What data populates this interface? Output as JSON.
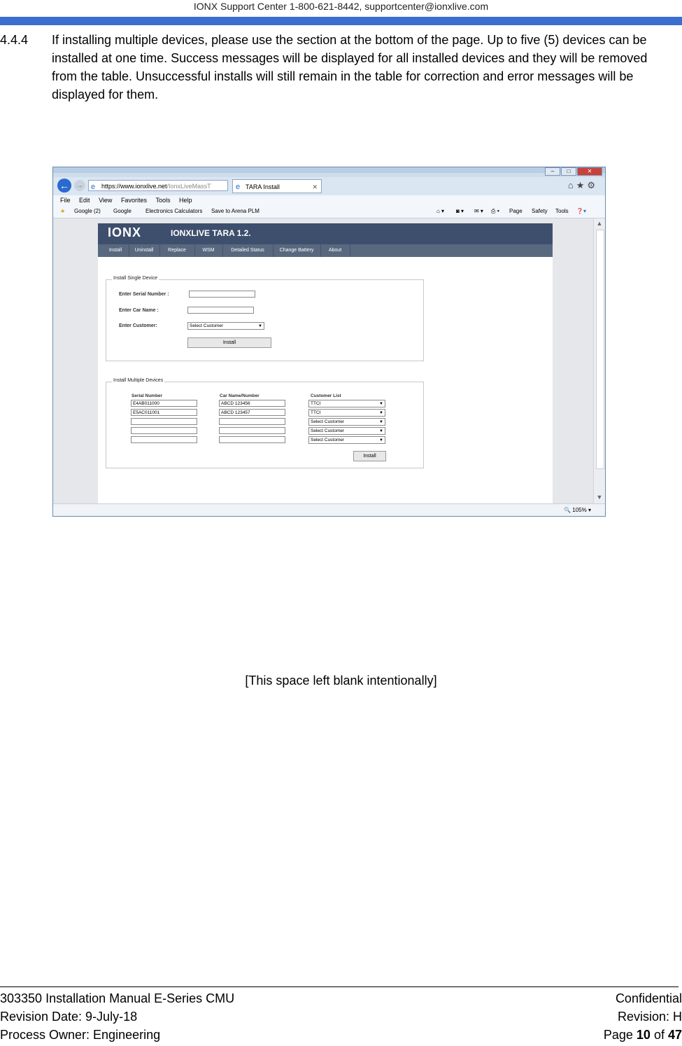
{
  "header": {
    "text": "IONX Support Center 1-800-621-8442, supportcenter@ionxlive.com"
  },
  "section": {
    "number": "4.4.4",
    "text": "If installing multiple devices, please use the section at the bottom of the page. Up to five (5) devices can be installed at one time. Success messages will be displayed for all installed devices and they will be removed from the table. Unsuccessful installs will still remain in the table for correction and error messages will be displayed for them."
  },
  "browser": {
    "url_host": "https://www.ionxlive.net",
    "url_rest": "/IonxLiveMassT",
    "tab_title": "TARA Install",
    "menu": [
      "File",
      "Edit",
      "View",
      "Favorites",
      "Tools",
      "Help"
    ],
    "favorites": [
      "Google (2)",
      "Google",
      "Electronics Calculators",
      "Save to Arena PLM"
    ],
    "commands": [
      "Page",
      "Safety",
      "Tools"
    ],
    "zoom": "105%"
  },
  "app": {
    "logo": "IONX",
    "title": "IONXLIVE TARA   1.2.",
    "tabs": [
      "Install",
      "Uninstall",
      "Replace",
      "WSM",
      "Detailed Status",
      "Change Battery",
      "About"
    ],
    "single": {
      "legend": "Install Single Device",
      "serial_label": "Enter Serial Number :",
      "car_label": "Enter Car Name :",
      "customer_label": "Enter Customer:",
      "customer_value": "Select Customer",
      "install_label": "Install"
    },
    "multi": {
      "legend": "Install Multiple Devices",
      "col_serial": "Serial Number",
      "col_car": "Car Name/Number",
      "col_customer": "Customer List",
      "rows": [
        {
          "serial": "E4AB011000",
          "car": "ABCD 123456",
          "customer": "TTCI"
        },
        {
          "serial": "E5AC011001",
          "car": "ABCD 123457",
          "customer": "TTCI"
        },
        {
          "serial": "",
          "car": "",
          "customer": "Select Customer"
        },
        {
          "serial": "",
          "car": "",
          "customer": "Select Customer"
        },
        {
          "serial": "",
          "car": "",
          "customer": "Select Customer"
        }
      ],
      "install_label": "Install"
    }
  },
  "blank_note": "[This space left blank intentionally]",
  "footer": {
    "doc": "303350 Installation Manual E-Series CMU",
    "confidential": "Confidential",
    "revision_date": "Revision Date: 9-July-18",
    "revision": "Revision: H",
    "owner": "Process Owner:  Engineering",
    "page_prefix": "Page ",
    "page_num": "10",
    "page_of": " of ",
    "page_total": "47"
  }
}
